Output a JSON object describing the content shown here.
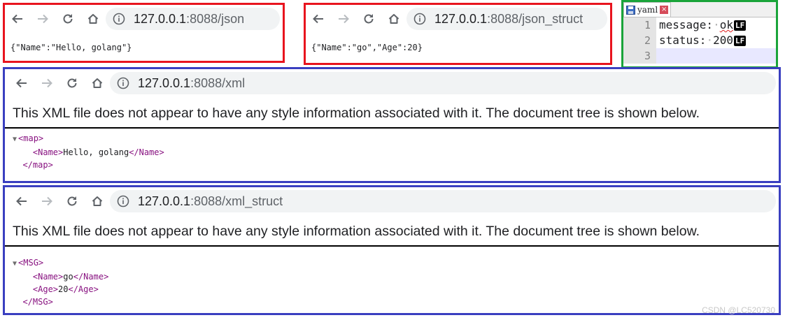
{
  "json_window": {
    "url_host": "127.0.0.1",
    "url_path": ":8088/json",
    "body": "{\"Name\":\"Hello, golang\"}"
  },
  "json_struct_window": {
    "url_host": "127.0.0.1",
    "url_path": ":8088/json_struct",
    "body": "{\"Name\":\"go\",\"Age\":20}"
  },
  "yaml_editor": {
    "tab_label": "yaml",
    "line_numbers": [
      "1",
      "2",
      "3"
    ],
    "line1": {
      "key": "message:",
      "value": "ok"
    },
    "line2": {
      "key": "status:",
      "value": "200"
    },
    "eol_marker": "LF"
  },
  "xml_window": {
    "url_host": "127.0.0.1",
    "url_path": ":8088/xml",
    "notice": "This XML file does not appear to have any style information associated with it. The document tree is shown below.",
    "root_open": "<map>",
    "child_open": "<Name>",
    "child_text": "Hello, golang",
    "child_close": "</Name>",
    "root_close": "</map>"
  },
  "xml_struct_window": {
    "url_host": "127.0.0.1",
    "url_path": ":8088/xml_struct",
    "notice": "This XML file does not appear to have any style information associated with it. The document tree is shown below.",
    "root_open": "<MSG>",
    "child1_open": "<Name>",
    "child1_text": "go",
    "child1_close": "</Name>",
    "child2_open": "<Age>",
    "child2_text": "20",
    "child2_close": "</Age>",
    "root_close": "</MSG>"
  },
  "toggle_glyph": "▼",
  "watermark": "CSDN @LC520730",
  "colors": {
    "frame_red": "#e8141e",
    "frame_blue": "#3a3fc0",
    "frame_green": "#1aa43a",
    "xml_tag": "#881280"
  }
}
